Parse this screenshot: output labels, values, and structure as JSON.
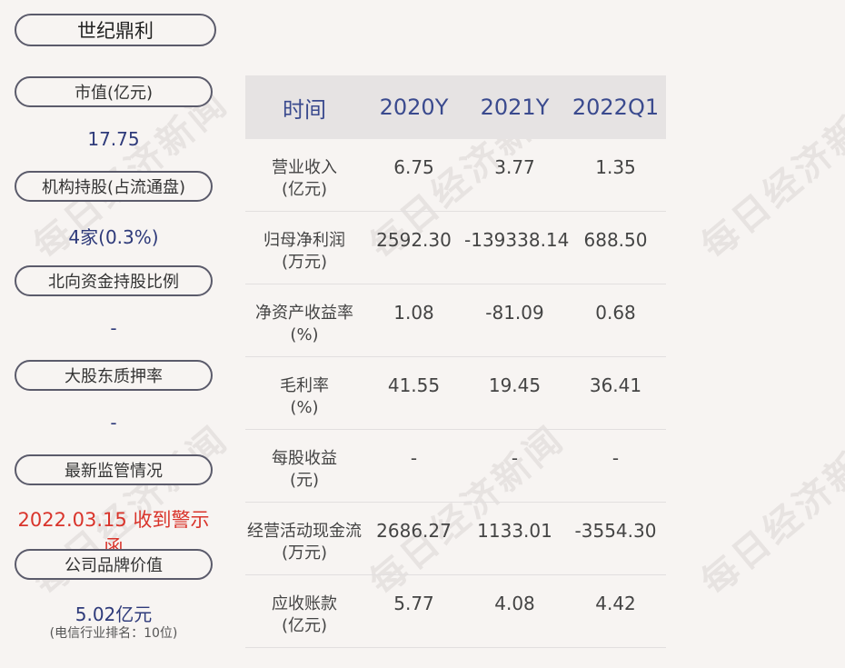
{
  "company": "世纪鼎利",
  "watermark": "每日经济新闻",
  "sidebar": {
    "market_cap_label": "市值(亿元)",
    "market_cap_value": "17.75",
    "institution_label": "机构持股(占流通盘)",
    "institution_value": "4家(0.3%)",
    "northbound_label": "北向资金持股比例",
    "northbound_value": "-",
    "pledge_label": "大股东质押率",
    "pledge_value": "-",
    "regulation_label": "最新监管情况",
    "regulation_value": "2022.03.15 收到警示函",
    "brand_label": "公司品牌价值",
    "brand_value": "5.02亿元",
    "brand_rank": "(电信行业排名：10位)"
  },
  "table": {
    "headers": [
      "时间",
      "2020Y",
      "2021Y",
      "2022Q1"
    ],
    "rows": [
      {
        "label1": "营业收入",
        "label2": "(亿元)",
        "values": [
          "6.75",
          "3.77",
          "1.35"
        ]
      },
      {
        "label1": "归母净利润",
        "label2": "(万元)",
        "values": [
          "2592.30",
          "-139338.14",
          "688.50"
        ]
      },
      {
        "label1": "净资产收益率",
        "label2": "(%)",
        "values": [
          "1.08",
          "-81.09",
          "0.68"
        ]
      },
      {
        "label1": "毛利率",
        "label2": "(%)",
        "values": [
          "41.55",
          "19.45",
          "36.41"
        ]
      },
      {
        "label1": "每股收益",
        "label2": "(元)",
        "values": [
          "-",
          "-",
          "-"
        ]
      },
      {
        "label1": "经营活动现金流",
        "label2": "(万元)",
        "values": [
          "2686.27",
          "1133.01",
          "-3554.30"
        ]
      },
      {
        "label1": "应收账款",
        "label2": "(亿元)",
        "values": [
          "5.77",
          "4.08",
          "4.42"
        ]
      }
    ]
  },
  "colors": {
    "accent": "#2e3a7a",
    "alert": "#d9342b",
    "header_bg": "#e6e3e3",
    "page_bg": "#f7f4f2"
  }
}
